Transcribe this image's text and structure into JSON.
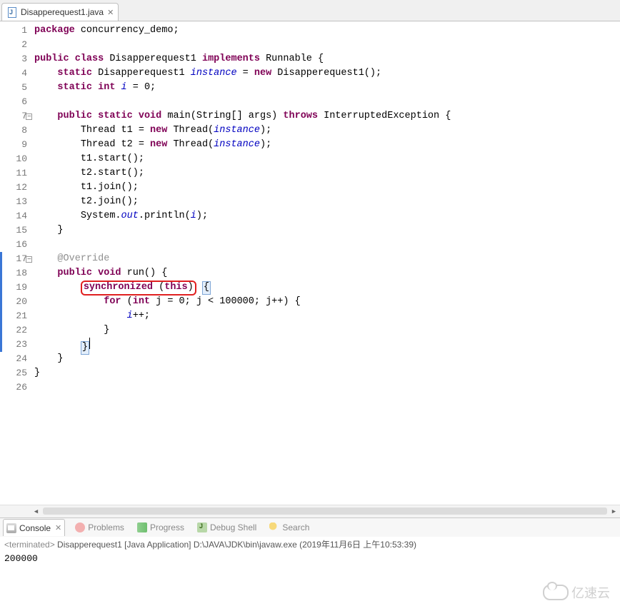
{
  "tab": {
    "filename": "Disapperequest1.java"
  },
  "code": {
    "lines": [
      {
        "n": 1,
        "pre": "",
        "segs": [
          [
            "kw",
            "package"
          ],
          [
            "lit",
            " concurrency_demo;"
          ]
        ]
      },
      {
        "n": 2,
        "pre": "",
        "segs": []
      },
      {
        "n": 3,
        "pre": "",
        "segs": [
          [
            "kw",
            "public"
          ],
          [
            "lit",
            " "
          ],
          [
            "kw",
            "class"
          ],
          [
            "lit",
            " Disapperequest1 "
          ],
          [
            "kw",
            "implements"
          ],
          [
            "lit",
            " Runnable {"
          ]
        ]
      },
      {
        "n": 4,
        "pre": "    ",
        "segs": [
          [
            "kw",
            "static"
          ],
          [
            "lit",
            " Disapperequest1 "
          ],
          [
            "static-i",
            "instance"
          ],
          [
            "lit",
            " = "
          ],
          [
            "kw",
            "new"
          ],
          [
            "lit",
            " Disapperequest1();"
          ]
        ]
      },
      {
        "n": 5,
        "pre": "    ",
        "segs": [
          [
            "kw",
            "static"
          ],
          [
            "lit",
            " "
          ],
          [
            "kw",
            "int"
          ],
          [
            "lit",
            " "
          ],
          [
            "static-i",
            "i"
          ],
          [
            "lit",
            " = 0;"
          ]
        ]
      },
      {
        "n": 6,
        "pre": "",
        "segs": []
      },
      {
        "n": 7,
        "pre": "    ",
        "fold": true,
        "segs": [
          [
            "kw",
            "public"
          ],
          [
            "lit",
            " "
          ],
          [
            "kw",
            "static"
          ],
          [
            "lit",
            " "
          ],
          [
            "kw",
            "void"
          ],
          [
            "lit",
            " main(String[] args) "
          ],
          [
            "kw",
            "throws"
          ],
          [
            "lit",
            " InterruptedException {"
          ]
        ]
      },
      {
        "n": 8,
        "pre": "        ",
        "segs": [
          [
            "lit",
            "Thread t1 = "
          ],
          [
            "kw",
            "new"
          ],
          [
            "lit",
            " Thread("
          ],
          [
            "static-i",
            "instance"
          ],
          [
            "lit",
            ");"
          ]
        ]
      },
      {
        "n": 9,
        "pre": "        ",
        "segs": [
          [
            "lit",
            "Thread t2 = "
          ],
          [
            "kw",
            "new"
          ],
          [
            "lit",
            " Thread("
          ],
          [
            "static-i",
            "instance"
          ],
          [
            "lit",
            ");"
          ]
        ]
      },
      {
        "n": 10,
        "pre": "        ",
        "segs": [
          [
            "lit",
            "t1.start();"
          ]
        ]
      },
      {
        "n": 11,
        "pre": "        ",
        "segs": [
          [
            "lit",
            "t2.start();"
          ]
        ]
      },
      {
        "n": 12,
        "pre": "        ",
        "segs": [
          [
            "lit",
            "t1.join();"
          ]
        ]
      },
      {
        "n": 13,
        "pre": "        ",
        "segs": [
          [
            "lit",
            "t2.join();"
          ]
        ]
      },
      {
        "n": 14,
        "pre": "        ",
        "segs": [
          [
            "lit",
            "System."
          ],
          [
            "static-i",
            "out"
          ],
          [
            "lit",
            ".println("
          ],
          [
            "static-i",
            "i"
          ],
          [
            "lit",
            ");"
          ]
        ]
      },
      {
        "n": 15,
        "pre": "    ",
        "segs": [
          [
            "lit",
            "}"
          ]
        ]
      },
      {
        "n": 16,
        "pre": "",
        "segs": []
      },
      {
        "n": 17,
        "pre": "    ",
        "fold": true,
        "bluebar": true,
        "segs": [
          [
            "comment-ann",
            "@Override"
          ]
        ]
      },
      {
        "n": 18,
        "pre": "    ",
        "bluebar": true,
        "segs": [
          [
            "kw",
            "public"
          ],
          [
            "lit",
            " "
          ],
          [
            "kw",
            "void"
          ],
          [
            "lit",
            " run() {"
          ]
        ]
      },
      {
        "n": 19,
        "pre": "        ",
        "bluebar": true,
        "boxed": true,
        "segs": [
          [
            "kw",
            "synchronized"
          ],
          [
            "lit",
            " ("
          ],
          [
            "kw",
            "this"
          ],
          [
            "lit",
            ")"
          ]
        ],
        "tail": " {"
      },
      {
        "n": 20,
        "pre": "            ",
        "bluebar": true,
        "segs": [
          [
            "kw",
            "for"
          ],
          [
            "lit",
            " ("
          ],
          [
            "kw",
            "int"
          ],
          [
            "lit",
            " j = 0; j < 100000; j++) {"
          ]
        ]
      },
      {
        "n": 21,
        "pre": "                ",
        "bluebar": true,
        "segs": [
          [
            "static-i",
            "i"
          ],
          [
            "lit",
            "++;"
          ]
        ]
      },
      {
        "n": 22,
        "pre": "            ",
        "bluebar": true,
        "segs": [
          [
            "lit",
            "}"
          ]
        ]
      },
      {
        "n": 23,
        "pre": "        ",
        "bluebar": true,
        "highlight": true,
        "cursor": true,
        "segs": [
          [
            "lit",
            "}"
          ]
        ]
      },
      {
        "n": 24,
        "pre": "    ",
        "segs": [
          [
            "lit",
            "}"
          ]
        ]
      },
      {
        "n": 25,
        "pre": "",
        "segs": [
          [
            "lit",
            "}"
          ]
        ]
      },
      {
        "n": 26,
        "pre": "",
        "segs": []
      }
    ]
  },
  "views": {
    "console": "Console",
    "problems": "Problems",
    "progress": "Progress",
    "debug": "Debug Shell",
    "search": "Search"
  },
  "console": {
    "status_prefix": "<terminated>",
    "headline": " Disapperequest1 [Java Application] D:\\JAVA\\JDK\\bin\\javaw.exe (2019年11月6日 上午10:53:39)",
    "output": "200000"
  },
  "watermark": "亿速云"
}
